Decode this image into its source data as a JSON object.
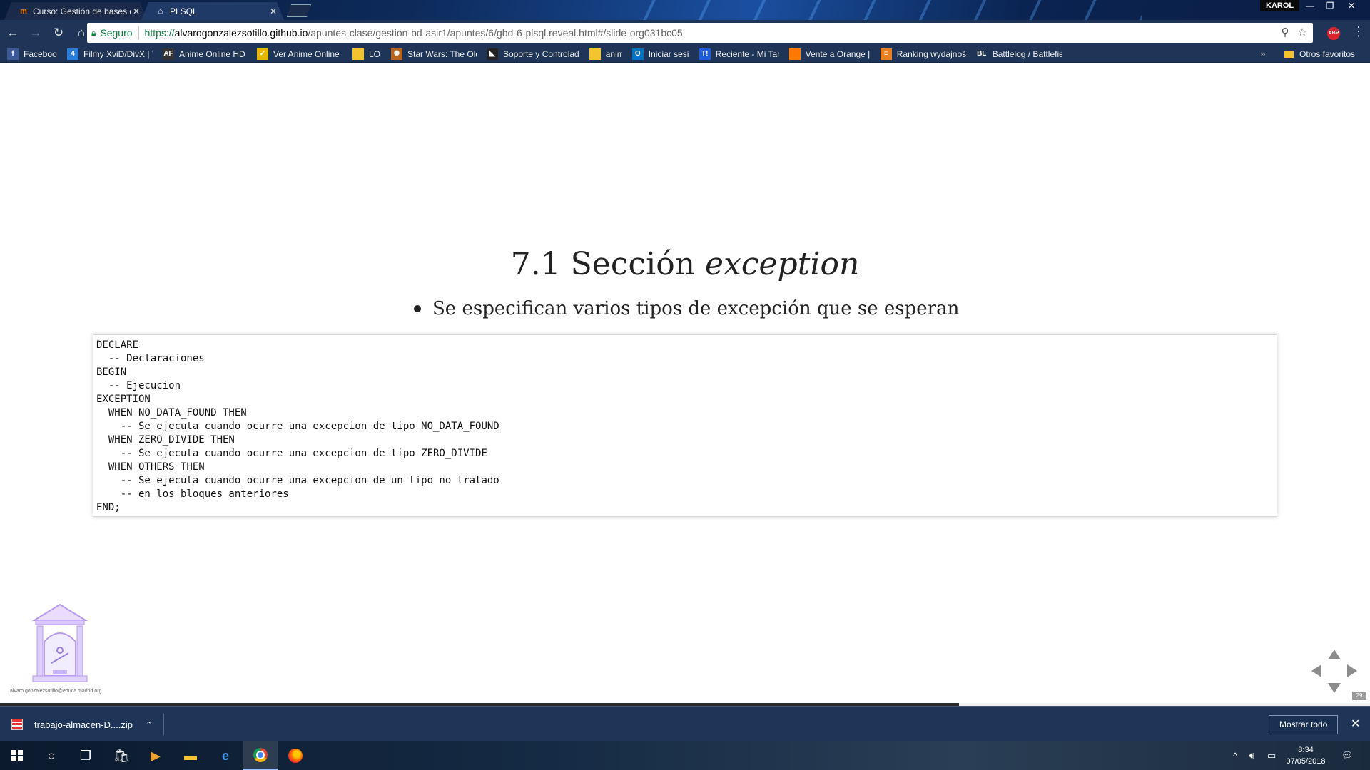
{
  "browser": {
    "tabs": [
      {
        "title": "Curso: Gestión de bases de datos",
        "icon": "moodle-icon",
        "active": false
      },
      {
        "title": "PLSQL",
        "icon": "building-icon",
        "active": true
      }
    ],
    "profile_name": "KAROL",
    "omnibox": {
      "security_label": "Seguro",
      "url_protocol": "https://",
      "url_host": "alvarogonzalezsotillo.github.io",
      "url_path": "/apuntes-clase/gestion-bd-asir1/apuntes/6/gbd-6-plsql.reveal.html#/slide-org031bc05"
    },
    "extension_label": "ABP",
    "bookmarks": [
      {
        "label": "Facebook",
        "icon": "facebook-icon",
        "color": "#3b5998",
        "glyph": "f"
      },
      {
        "label": "Filmy XviD/DivX | To",
        "icon": "filmy-icon",
        "color": "#2c7bd6",
        "glyph": "4"
      },
      {
        "label": "Anime Online HD su",
        "icon": "anime-hd-icon",
        "color": "#333333",
        "glyph": "AF"
      },
      {
        "label": "Ver Anime Online - t",
        "icon": "ver-anime-icon",
        "color": "#e6b800",
        "glyph": "✓"
      },
      {
        "label": "LOL",
        "icon": "folder-icon",
        "color": "#f4c430",
        "glyph": ""
      },
      {
        "label": "Star Wars: The Old R",
        "icon": "star-wars-icon",
        "color": "#b5651d",
        "glyph": "✺"
      },
      {
        "label": "Soporte y Controlad",
        "icon": "amd-icon",
        "color": "#222222",
        "glyph": "◣"
      },
      {
        "label": "anime",
        "icon": "folder-icon",
        "color": "#f4c430",
        "glyph": ""
      },
      {
        "label": "Iniciar sesión",
        "icon": "outlook-icon",
        "color": "#0072c6",
        "glyph": "O"
      },
      {
        "label": "Reciente - Mi Taring",
        "icon": "taringa-icon",
        "color": "#1e5bd6",
        "glyph": "T!"
      },
      {
        "label": "Vente a Orange | Mo",
        "icon": "orange-icon",
        "color": "#ff7900",
        "glyph": ""
      },
      {
        "label": "Ranking wydajności",
        "icon": "ranking-icon",
        "color": "#e67e22",
        "glyph": "≡"
      },
      {
        "label": "Battlelog / Battlefiel",
        "icon": "battlelog-icon",
        "color": "#1e3558",
        "glyph": "BL"
      }
    ],
    "bookmarks_overflow": "»",
    "other_bookmarks": "Otros favoritos"
  },
  "slide": {
    "title_prefix": "7.1 Sección ",
    "title_emphasis": "exception",
    "bullet": "Se especifican varios tipos de excepción que se esperan",
    "code_lines": [
      "DECLARE",
      "  -- Declaraciones",
      "BEGIN",
      "  -- Ejecucion",
      "EXCEPTION",
      "  WHEN NO_DATA_FOUND THEN",
      "    -- Se ejecuta cuando ocurre una excepcion de tipo NO_DATA_FOUND",
      "  WHEN ZERO_DIVIDE THEN",
      "    -- Se ejecuta cuando ocurre una excepcion de tipo ZERO_DIVIDE",
      "  WHEN OTHERS THEN",
      "    -- Se ejecuta cuando ocurre una excepcion de un tipo no tratado",
      "    -- en los bloques anteriores",
      "END;"
    ],
    "author_email": "alvaro.gonzalezsotillo@educa.madrid.org",
    "slide_number": "29",
    "progress_fraction": 0.7
  },
  "downloads": {
    "file_name": "trabajo-almacen-D....zip",
    "show_all_label": "Mostrar todo"
  },
  "taskbar": {
    "time": "8:34",
    "date": "07/05/2018"
  }
}
